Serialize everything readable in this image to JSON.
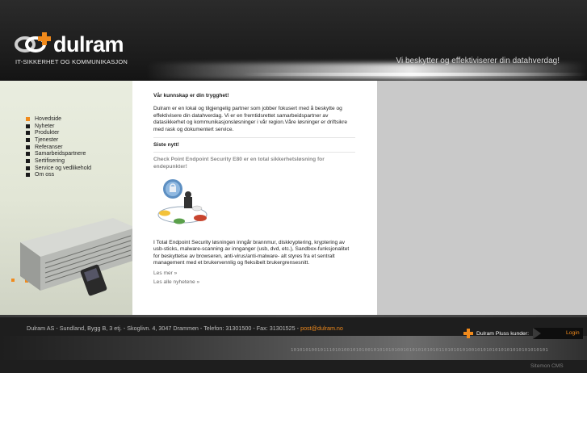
{
  "header": {
    "logo_name": "dulram",
    "logo_subtitle": "IT-SIKKERHET OG KOMMUNIKASJON",
    "tagline": "Vi beskytter og effektiviserer din datahverdag!"
  },
  "nav": {
    "items": [
      "Hovedside",
      "Nyheter",
      "Produkter",
      "Tjenester",
      "Referanser",
      "Samarbeidspartnere",
      "Sertifisering",
      "Service og vedlikehold",
      "Om oss"
    ],
    "active_index": 0
  },
  "content": {
    "heading": "Vår kunnskap er din trygghet!",
    "intro": "Dulram er en lokal og tilgjengelig partner som jobber fokusert med å beskytte og effektivisere din datahverdag. Vi er en fremtidsrettet samarbeidspartner av datasikkerhet og kommunikasjonsløsninger i vår region.Våre løsninger er driftsikre med rask og dokumentert service.",
    "news_heading": "Siste nytt!",
    "news_title": "Check Point Endpoint Security E80 er en total sikkerhetsløsning for endepunkter!",
    "news_body": "I Total Endpoint Security løsningen inngår brannmur, diskkryptering, kryptering av usb-sticks, malware-scanning av innganger (usb, dvd, etc.), Sandbox-funksjonalitet for beskyttelse av browseren, anti-virus/anti-malware- alt styres fra et sentralt management med et brukervennlig og fleksibelt brukergrensesnitt.",
    "read_more": "Les mer »",
    "all_news": "Les alle nyhetene »"
  },
  "footer": {
    "address": "Dulram AS - Sundland, Bygg B, 3 etj. - Skoglivn. 4, 3047 Drammen - Telefon: 31301500 - Fax: 31301525 - ",
    "email": "post@dulram.no",
    "pluss_label": "Dulram Pluss kunder:",
    "login_label": "Login",
    "binary": "101010100101110101001010100101010101001010101010101101010101001010101010101010101010101",
    "cms": "Sitemon CMS"
  },
  "colors": {
    "accent": "#f08a1c",
    "header_bg": "#1c1c1c",
    "left_bg": "#e4e8d8",
    "right_bg": "#c9c9c9",
    "footer_bg": "#1e1e1e"
  }
}
